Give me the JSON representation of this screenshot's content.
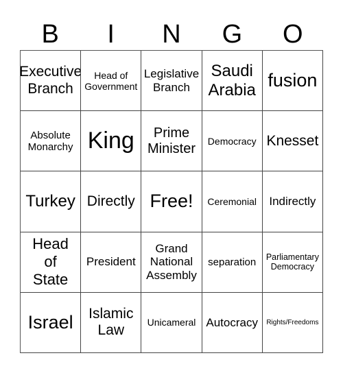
{
  "header": {
    "letters": [
      "B",
      "I",
      "N",
      "G",
      "O"
    ]
  },
  "board": {
    "rows": [
      [
        "Executive Branch",
        "Head of Government",
        "Legislative Branch",
        "Saudi Arabia",
        "fusion"
      ],
      [
        "Absolute Monarchy",
        "King",
        "Prime Minister",
        "Democracy",
        "Knesset"
      ],
      [
        "Turkey",
        "Directly",
        "Free!",
        "Ceremonial",
        "Indirectly"
      ],
      [
        "Head of State",
        "President",
        "Grand National Assembly",
        "separation",
        "Parliamentary Democracy"
      ],
      [
        "Israel",
        "Islamic Law",
        "Unicameral",
        "Autocracy",
        "Rights/Freedoms"
      ]
    ],
    "free_space": "Free!"
  }
}
